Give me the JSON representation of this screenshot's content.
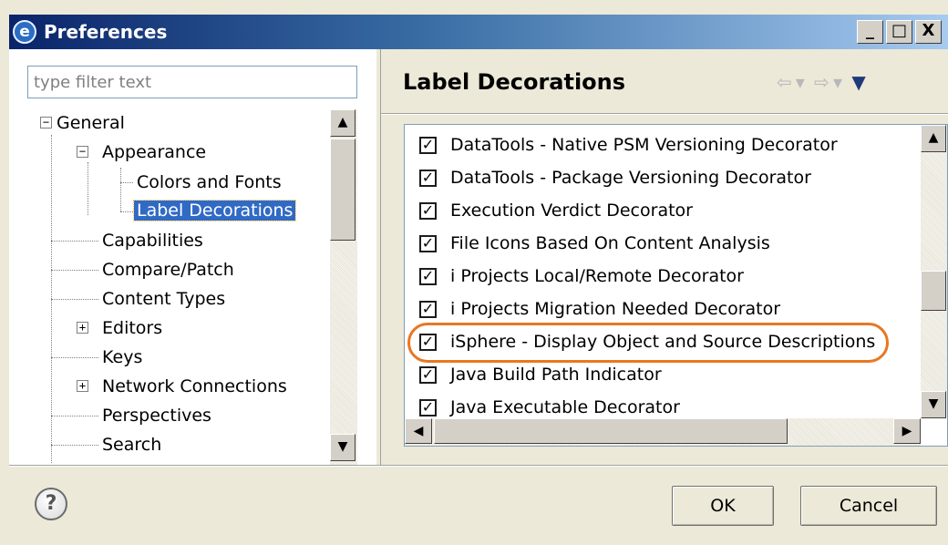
{
  "window": {
    "title": "Preferences",
    "icon": "eclipse-app-icon",
    "controls": {
      "minimize": "_",
      "maximize": "□",
      "close": "X"
    }
  },
  "filter": {
    "placeholder": "type filter text",
    "value": ""
  },
  "tree": {
    "items": [
      {
        "label": "General",
        "expander": "−"
      },
      {
        "label": "Appearance",
        "expander": "−"
      },
      {
        "label": "Colors and Fonts"
      },
      {
        "label": "Label Decorations",
        "selected": true
      },
      {
        "label": "Capabilities"
      },
      {
        "label": "Compare/Patch"
      },
      {
        "label": "Content Types"
      },
      {
        "label": "Editors",
        "expander": "+"
      },
      {
        "label": "Keys"
      },
      {
        "label": "Network Connections",
        "expander": "+"
      },
      {
        "label": "Perspectives"
      },
      {
        "label": "Search"
      }
    ]
  },
  "page": {
    "title": "Label Decorations",
    "nav": {
      "back": "⇦",
      "back_menu": "▾",
      "forward": "⇨",
      "forward_menu": "▾",
      "view_menu": "▼"
    }
  },
  "decorators": [
    {
      "label": "DataTools - Native PSM Versioning Decorator",
      "checked": true
    },
    {
      "label": "DataTools - Package Versioning Decorator",
      "checked": true
    },
    {
      "label": "Execution Verdict Decorator",
      "checked": true
    },
    {
      "label": "File Icons Based On Content Analysis",
      "checked": true
    },
    {
      "label": "i Projects Local/Remote Decorator",
      "checked": true
    },
    {
      "label": "i Projects Migration Needed Decorator",
      "checked": true
    },
    {
      "label": "iSphere - Display Object and Source Descriptions",
      "checked": true,
      "highlighted": true
    },
    {
      "label": "Java Build Path Indicator",
      "checked": true
    },
    {
      "label": "Java Executable Decorator",
      "checked": true
    }
  ],
  "scroll_glyphs": {
    "up": "▲",
    "down": "▼",
    "left": "◀",
    "right": "▶"
  },
  "footer": {
    "help": "?",
    "ok": "OK",
    "cancel": "Cancel"
  },
  "colors": {
    "selection": "#316ac5",
    "highlight_oval": "#e87722",
    "titlebar_start": "#0a246a"
  }
}
